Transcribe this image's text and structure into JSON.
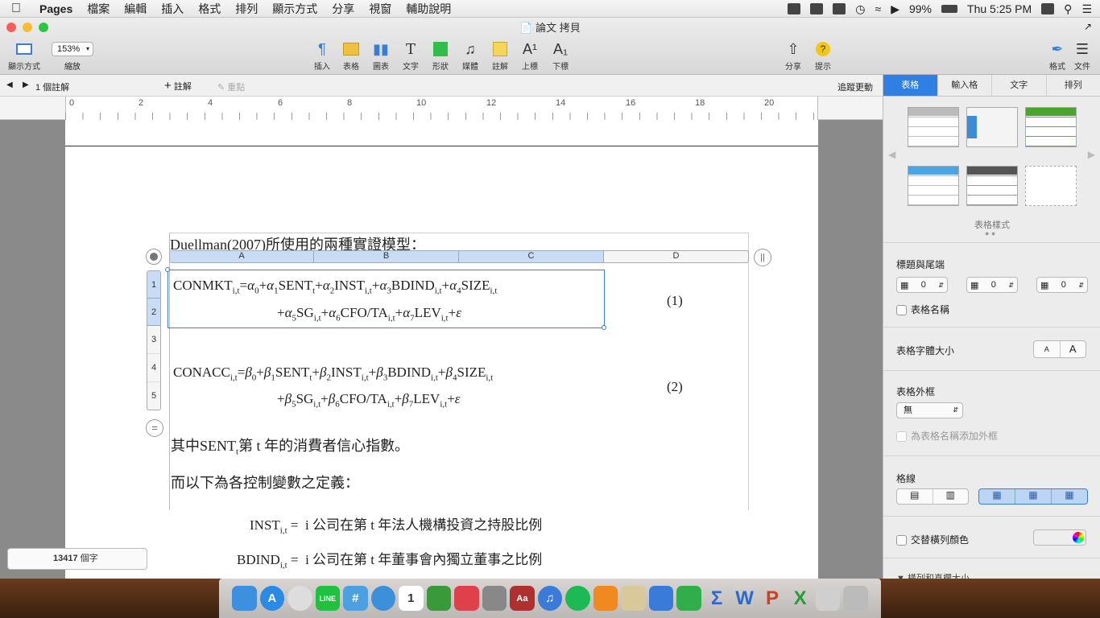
{
  "menubar": {
    "app": "Pages",
    "items": [
      "檔案",
      "編輯",
      "插入",
      "格式",
      "排列",
      "顯示方式",
      "分享",
      "視窗",
      "輔助說明"
    ],
    "battery": "99%",
    "clock": "Thu 5:25 PM"
  },
  "window": {
    "title": "論文 拷貝"
  },
  "toolbar": {
    "view_label": "顯示方式",
    "zoom_value": "153%",
    "zoom_label": "縮放",
    "buttons": [
      "插入",
      "表格",
      "圖表",
      "文字",
      "形狀",
      "媒體",
      "註解",
      "上標",
      "下標"
    ],
    "share": "分享",
    "tips": "提示",
    "format": "格式",
    "document": "文件"
  },
  "subbar": {
    "comments": "1 個註解",
    "add_comment": "註解",
    "highlight": "重點",
    "track_changes": "追蹤更動"
  },
  "ruler": [
    "0",
    "2",
    "4",
    "6",
    "8",
    "10",
    "12",
    "14",
    "16",
    "18",
    "20"
  ],
  "doc": {
    "heading": "Duellman(2007)所使用的兩種實證模型：",
    "columns": [
      "A",
      "B",
      "C",
      "D"
    ],
    "rows": [
      "1",
      "2",
      "3",
      "4",
      "5"
    ],
    "eq1_line1": "CONMKT",
    "eq1_num": "(1)",
    "eq2_num": "(2)",
    "sentence1": "其中SENT",
    "sentence1_rest": "第 t 年的消費者信心指數。",
    "sentence2": "而以下為各控制變數之定義：",
    "def1_term": "INST",
    "def1_text": "i 公司在第 t 年法人機構投資之持股比例",
    "def2_term": "BDIND",
    "def2_text": "i 公司在第 t 年董事會內獨立董事之比例",
    "word_count": "13417",
    "word_unit": "個字"
  },
  "sidebar": {
    "tabs": [
      "表格",
      "輸入格",
      "文字",
      "排列"
    ],
    "styles_label": "表格樣式",
    "header_footer": "標題與尾端",
    "stepper_values": [
      "0",
      "0",
      "0"
    ],
    "table_name": "表格名稱",
    "font_size": "表格字體大小",
    "font_small": "A",
    "font_large": "A",
    "border": "表格外框",
    "border_value": "無",
    "border_name": "為表格名稱添加外框",
    "gridlines": "格線",
    "alt_row": "交替橫列顏色",
    "rows_cols": "橫列和直欄大小"
  },
  "colors": {
    "accent": "#2f7fe5",
    "selection": "#c9dcf5"
  }
}
